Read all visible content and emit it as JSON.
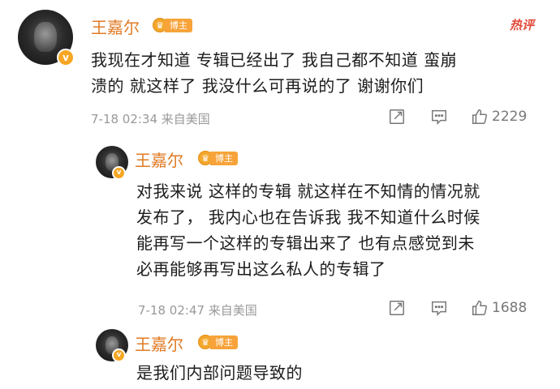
{
  "hot_label": "热评",
  "comments": [
    {
      "author": "王嘉尔",
      "badge": "博主",
      "text_lines": [
        "我现在才知道 专辑已经出了 我自己都不知道 蛮崩",
        "溃的  就这样了 我没什么可再说的了  谢谢你们"
      ],
      "meta": "7-18 02:34  来自美国",
      "likes": "2229"
    },
    {
      "author": "王嘉尔",
      "badge": "博主",
      "text_lines": [
        "对我来说 这样的专辑 就这样在不知情的情况就",
        "发布了，  我内心也在告诉我 我不知道什么时候",
        "能再写一个这样的专辑出来了 也有点感觉到未",
        "必再能够再写出这么私人的专辑了"
      ],
      "meta": "7-18 02:47  来自美国",
      "likes": "1688"
    },
    {
      "author": "王嘉尔",
      "badge": "博主",
      "text_lines": [
        "是我们内部问题导致的"
      ]
    }
  ],
  "icons": {
    "share": "share-icon",
    "comment": "comment-icon",
    "like": "like-icon"
  },
  "colors": {
    "name": "#e07b25",
    "badge": "#f7a33a",
    "hot": "#e24a3b",
    "meta": "#999999"
  }
}
